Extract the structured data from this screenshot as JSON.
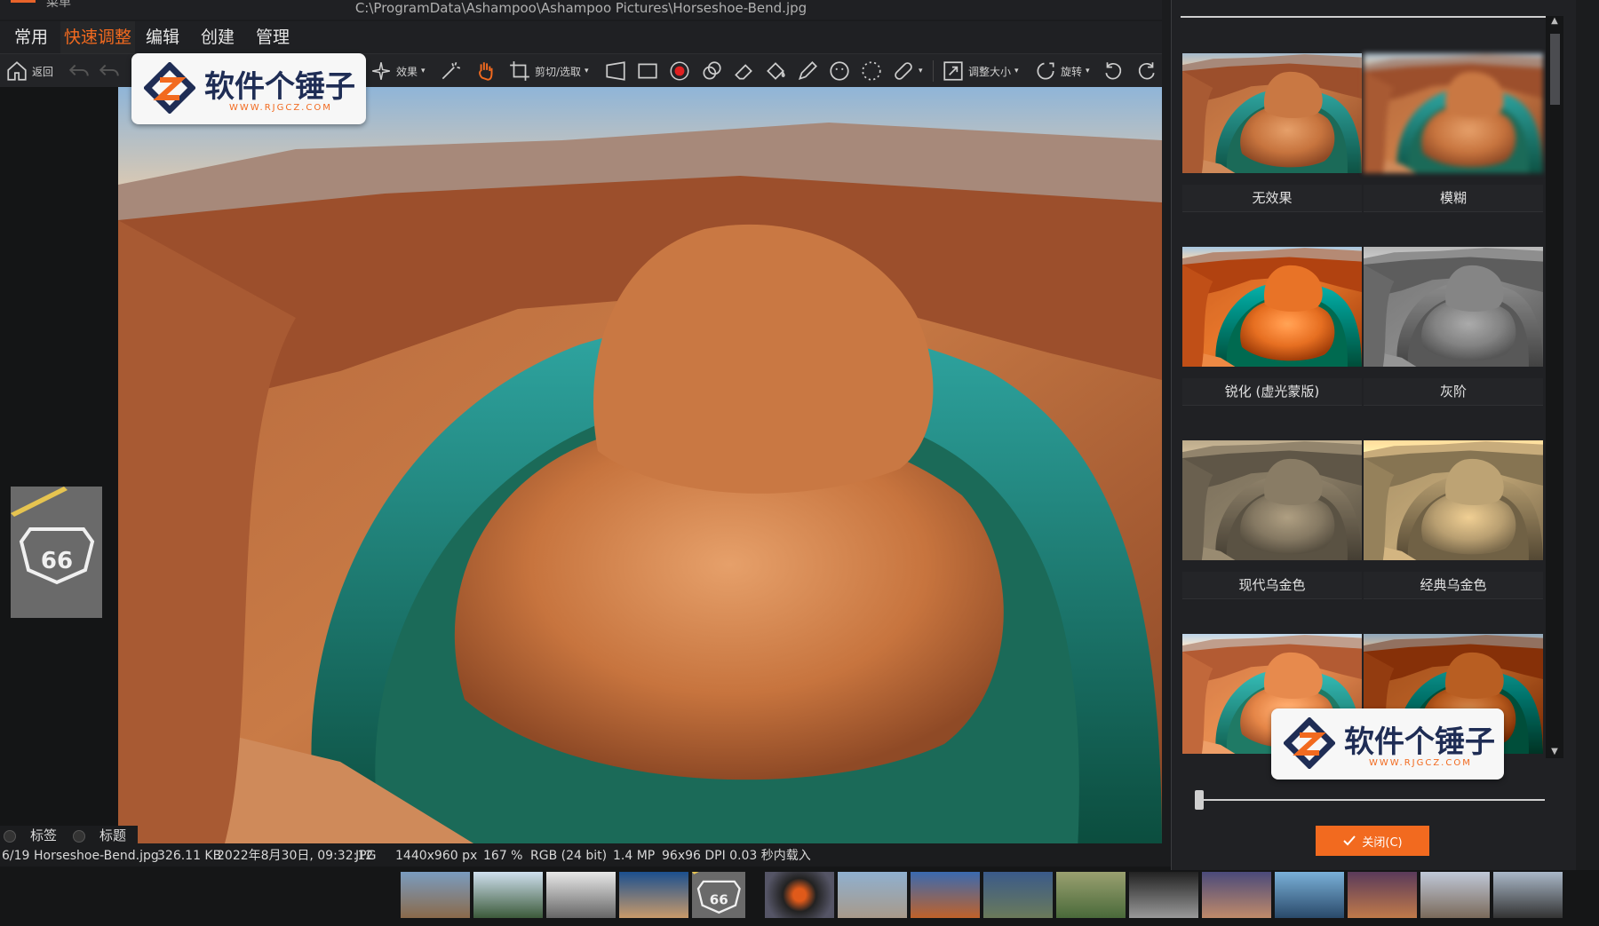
{
  "window": {
    "path": "C:\\ProgramData\\Ashampoo\\Ashampoo Pictures\\Horseshoe-Bend.jpg",
    "menu_label": "菜单"
  },
  "menu": {
    "tabs": [
      {
        "label": "常用",
        "active": false
      },
      {
        "label": "快速调整",
        "active": true
      },
      {
        "label": "编辑",
        "active": false
      },
      {
        "label": "创建",
        "active": false
      },
      {
        "label": "管理",
        "active": false
      }
    ]
  },
  "toolbar": {
    "back_label": "返回",
    "effects_label": "效果",
    "crop_label": "剪切/选取",
    "resize_label": "调整大小",
    "rotate_label": "旋转"
  },
  "watermark": {
    "text": "软件个锤子",
    "sub": "WWW.RJGCZ.COM"
  },
  "tags": {
    "tag_label": "标签",
    "title_label": "标题"
  },
  "status": {
    "index": "6/19",
    "filename": "Horseshoe-Bend.jpg",
    "filesize": "326.11 KB",
    "datetime": "2022年8月30日, 09:32:12",
    "format": "JPG",
    "dimensions": "1440x960 px",
    "zoom": "167 %",
    "color": "RGB (24 bit)",
    "megapixels": "1.4 MP",
    "dpi_load": "96x96 DPI 0.03 秒内载入"
  },
  "effects_panel": {
    "effects": [
      {
        "label": "无效果"
      },
      {
        "label": "模糊"
      },
      {
        "label": "锐化 (虚光蒙版)"
      },
      {
        "label": "灰阶"
      },
      {
        "label": "现代乌金色"
      },
      {
        "label": "经典乌金色"
      }
    ],
    "close_label": "关闭(C)",
    "accent": "#f26a1f"
  }
}
